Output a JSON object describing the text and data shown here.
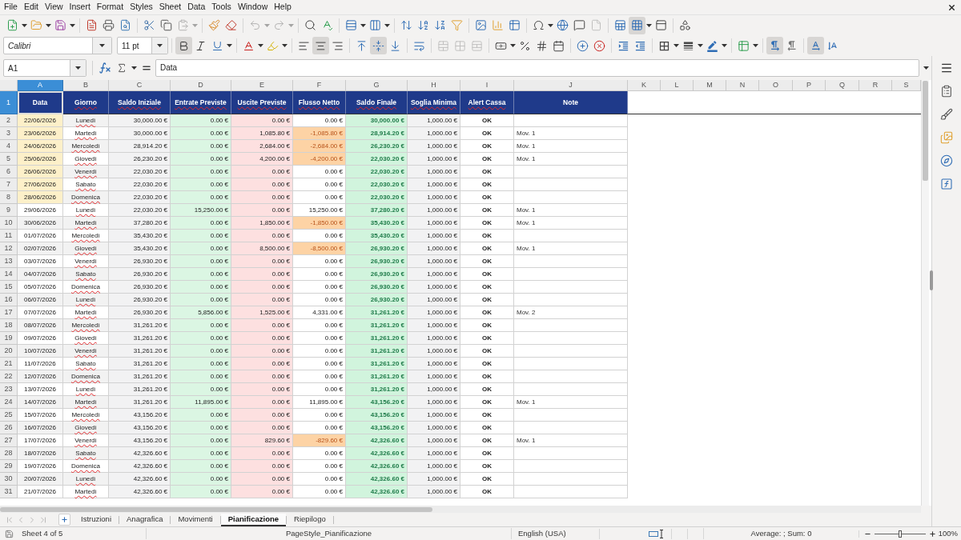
{
  "menu": [
    "File",
    "Edit",
    "View",
    "Insert",
    "Format",
    "Styles",
    "Sheet",
    "Data",
    "Tools",
    "Window",
    "Help"
  ],
  "toolbar_states": {
    "paste": {
      "disabled": true
    },
    "undo": {
      "disabled": true
    },
    "redo": {
      "disabled": true
    },
    "headers_footers": {
      "disabled": true
    },
    "freeze": {
      "pressed": true
    },
    "bold": {
      "pressed": true
    },
    "italic": {
      "pressed": false
    },
    "underline": {
      "pressed": false
    },
    "align_left": {
      "pressed": false
    },
    "align_center": {
      "pressed": true
    },
    "align_right": {
      "pressed": false
    },
    "valign_top": {
      "pressed": false
    },
    "valign_middle": {
      "pressed": true
    },
    "valign_bottom": {
      "pressed": false
    },
    "merge_center": {
      "disabled": true
    },
    "merge": {
      "disabled": true
    },
    "unmerge": {
      "disabled": true
    },
    "paragraph_ltr": {
      "pressed": true
    },
    "paragraph_rtl": {
      "pressed": false
    },
    "text_horizontal": {
      "pressed": true
    },
    "text_vertical": {
      "pressed": false
    }
  },
  "font": {
    "name": "Calibri",
    "size": "11 pt"
  },
  "formula_bar": {
    "cell_reference": "A1",
    "content": "Data"
  },
  "columns": [
    {
      "letter": "A",
      "selected": true
    },
    {
      "letter": "B",
      "selected": false
    },
    {
      "letter": "C",
      "selected": false
    },
    {
      "letter": "D",
      "selected": false
    },
    {
      "letter": "E",
      "selected": false
    },
    {
      "letter": "F",
      "selected": false
    },
    {
      "letter": "G",
      "selected": false
    },
    {
      "letter": "H",
      "selected": false
    },
    {
      "letter": "I",
      "selected": false
    },
    {
      "letter": "J",
      "selected": false
    },
    {
      "letter": "K",
      "selected": false
    },
    {
      "letter": "L",
      "selected": false
    },
    {
      "letter": "M",
      "selected": false
    },
    {
      "letter": "N",
      "selected": false
    },
    {
      "letter": "O",
      "selected": false
    },
    {
      "letter": "P",
      "selected": false
    },
    {
      "letter": "Q",
      "selected": false
    },
    {
      "letter": "R",
      "selected": false
    },
    {
      "letter": "S",
      "selected": false
    }
  ],
  "table": {
    "header_row": {
      "number": "1",
      "selected": true
    },
    "headers": [
      {
        "title": "Data",
        "selected": true,
        "misspelled": false,
        "values_misspelled": false
      },
      {
        "title": "Giorno",
        "selected": false,
        "misspelled": true,
        "values_misspelled": true
      },
      {
        "title": "Saldo Iniziale",
        "selected": false,
        "misspelled": true,
        "values_misspelled": false
      },
      {
        "title": "Entrate Previste",
        "selected": false,
        "misspelled": true,
        "values_misspelled": false
      },
      {
        "title": "Uscite Previste",
        "selected": false,
        "misspelled": true,
        "values_misspelled": false
      },
      {
        "title": "Flusso Netto",
        "selected": false,
        "misspelled": true,
        "values_misspelled": false
      },
      {
        "title": "Saldo Finale",
        "selected": false,
        "misspelled": true,
        "values_misspelled": false
      },
      {
        "title": "Soglia Minima",
        "selected": false,
        "misspelled": true,
        "values_misspelled": false
      },
      {
        "title": "Alert Cassa",
        "selected": false,
        "misspelled": true,
        "values_misspelled": false
      },
      {
        "title": "Note",
        "selected": false,
        "misspelled": false,
        "values_misspelled": false
      }
    ],
    "rows": [
      {
        "number": "2",
        "selected": false,
        "highlighted": true,
        "negative": false,
        "date": "22/06/2026",
        "day": "Lunedì",
        "opening": "30,000.00 €",
        "inflow": "0.00 €",
        "outflow": "0.00 €",
        "net": "0.00 €",
        "closing": "30,000.00 €",
        "threshold": "1,000.00 €",
        "alert": "OK"
      },
      {
        "number": "3",
        "selected": false,
        "highlighted": true,
        "negative": true,
        "date": "23/06/2026",
        "day": "Martedì",
        "opening": "30,000.00 €",
        "inflow": "0.00 €",
        "outflow": "1,085.80 €",
        "net": "-1,085.80 €",
        "closing": "28,914.20 €",
        "threshold": "1,000.00 €",
        "alert": "OK",
        "note": "Mov. 1"
      },
      {
        "number": "4",
        "selected": false,
        "highlighted": true,
        "negative": true,
        "date": "24/06/2026",
        "day": "Mercoledì",
        "opening": "28,914.20 €",
        "inflow": "0.00 €",
        "outflow": "2,684.00 €",
        "net": "-2,684.00 €",
        "closing": "26,230.20 €",
        "threshold": "1,000.00 €",
        "alert": "OK",
        "note": "Mov. 1"
      },
      {
        "number": "5",
        "selected": false,
        "highlighted": true,
        "negative": true,
        "date": "25/06/2026",
        "day": "Giovedì",
        "opening": "26,230.20 €",
        "inflow": "0.00 €",
        "outflow": "4,200.00 €",
        "net": "-4,200.00 €",
        "closing": "22,030.20 €",
        "threshold": "1,000.00 €",
        "alert": "OK",
        "note": "Mov. 1"
      },
      {
        "number": "6",
        "selected": false,
        "highlighted": true,
        "negative": false,
        "date": "26/06/2026",
        "day": "Venerdì",
        "opening": "22,030.20 €",
        "inflow": "0.00 €",
        "outflow": "0.00 €",
        "net": "0.00 €",
        "closing": "22,030.20 €",
        "threshold": "1,000.00 €",
        "alert": "OK"
      },
      {
        "number": "7",
        "selected": false,
        "highlighted": true,
        "negative": false,
        "date": "27/06/2026",
        "day": "Sabato",
        "opening": "22,030.20 €",
        "inflow": "0.00 €",
        "outflow": "0.00 €",
        "net": "0.00 €",
        "closing": "22,030.20 €",
        "threshold": "1,000.00 €",
        "alert": "OK"
      },
      {
        "number": "8",
        "selected": false,
        "highlighted": true,
        "negative": false,
        "date": "28/06/2026",
        "day": "Domenica",
        "opening": "22,030.20 €",
        "inflow": "0.00 €",
        "outflow": "0.00 €",
        "net": "0.00 €",
        "closing": "22,030.20 €",
        "threshold": "1,000.00 €",
        "alert": "OK"
      },
      {
        "number": "9",
        "selected": false,
        "highlighted": false,
        "negative": false,
        "date": "29/06/2026",
        "day": "Lunedì",
        "opening": "22,030.20 €",
        "inflow": "15,250.00 €",
        "outflow": "0.00 €",
        "net": "15,250.00 €",
        "closing": "37,280.20 €",
        "threshold": "1,000.00 €",
        "alert": "OK",
        "note": "Mov. 1"
      },
      {
        "number": "10",
        "selected": false,
        "highlighted": false,
        "negative": true,
        "date": "30/06/2026",
        "day": "Martedì",
        "opening": "37,280.20 €",
        "inflow": "0.00 €",
        "outflow": "1,850.00 €",
        "net": "-1,850.00 €",
        "closing": "35,430.20 €",
        "threshold": "1,000.00 €",
        "alert": "OK",
        "note": "Mov. 1"
      },
      {
        "number": "11",
        "selected": false,
        "highlighted": false,
        "negative": false,
        "date": "01/07/2026",
        "day": "Mercoledì",
        "opening": "35,430.20 €",
        "inflow": "0.00 €",
        "outflow": "0.00 €",
        "net": "0.00 €",
        "closing": "35,430.20 €",
        "threshold": "1,000.00 €",
        "alert": "OK"
      },
      {
        "number": "12",
        "selected": false,
        "highlighted": false,
        "negative": true,
        "date": "02/07/2026",
        "day": "Giovedì",
        "opening": "35,430.20 €",
        "inflow": "0.00 €",
        "outflow": "8,500.00 €",
        "net": "-8,500.00 €",
        "closing": "26,930.20 €",
        "threshold": "1,000.00 €",
        "alert": "OK",
        "note": "Mov. 1"
      },
      {
        "number": "13",
        "selected": false,
        "highlighted": false,
        "negative": false,
        "date": "03/07/2026",
        "day": "Venerdì",
        "opening": "26,930.20 €",
        "inflow": "0.00 €",
        "outflow": "0.00 €",
        "net": "0.00 €",
        "closing": "26,930.20 €",
        "threshold": "1,000.00 €",
        "alert": "OK"
      },
      {
        "number": "14",
        "selected": false,
        "highlighted": false,
        "negative": false,
        "date": "04/07/2026",
        "day": "Sabato",
        "opening": "26,930.20 €",
        "inflow": "0.00 €",
        "outflow": "0.00 €",
        "net": "0.00 €",
        "closing": "26,930.20 €",
        "threshold": "1,000.00 €",
        "alert": "OK"
      },
      {
        "number": "15",
        "selected": false,
        "highlighted": false,
        "negative": false,
        "date": "05/07/2026",
        "day": "Domenica",
        "opening": "26,930.20 €",
        "inflow": "0.00 €",
        "outflow": "0.00 €",
        "net": "0.00 €",
        "closing": "26,930.20 €",
        "threshold": "1,000.00 €",
        "alert": "OK"
      },
      {
        "number": "16",
        "selected": false,
        "highlighted": false,
        "negative": false,
        "date": "06/07/2026",
        "day": "Lunedì",
        "opening": "26,930.20 €",
        "inflow": "0.00 €",
        "outflow": "0.00 €",
        "net": "0.00 €",
        "closing": "26,930.20 €",
        "threshold": "1,000.00 €",
        "alert": "OK"
      },
      {
        "number": "17",
        "selected": false,
        "highlighted": false,
        "negative": false,
        "date": "07/07/2026",
        "day": "Martedì",
        "opening": "26,930.20 €",
        "inflow": "5,856.00 €",
        "outflow": "1,525.00 €",
        "net": "4,331.00 €",
        "closing": "31,261.20 €",
        "threshold": "1,000.00 €",
        "alert": "OK",
        "note": "Mov. 2"
      },
      {
        "number": "18",
        "selected": false,
        "highlighted": false,
        "negative": false,
        "date": "08/07/2026",
        "day": "Mercoledì",
        "opening": "31,261.20 €",
        "inflow": "0.00 €",
        "outflow": "0.00 €",
        "net": "0.00 €",
        "closing": "31,261.20 €",
        "threshold": "1,000.00 €",
        "alert": "OK"
      },
      {
        "number": "19",
        "selected": false,
        "highlighted": false,
        "negative": false,
        "date": "09/07/2026",
        "day": "Giovedì",
        "opening": "31,261.20 €",
        "inflow": "0.00 €",
        "outflow": "0.00 €",
        "net": "0.00 €",
        "closing": "31,261.20 €",
        "threshold": "1,000.00 €",
        "alert": "OK"
      },
      {
        "number": "20",
        "selected": false,
        "highlighted": false,
        "negative": false,
        "date": "10/07/2026",
        "day": "Venerdì",
        "opening": "31,261.20 €",
        "inflow": "0.00 €",
        "outflow": "0.00 €",
        "net": "0.00 €",
        "closing": "31,261.20 €",
        "threshold": "1,000.00 €",
        "alert": "OK"
      },
      {
        "number": "21",
        "selected": false,
        "highlighted": false,
        "negative": false,
        "date": "11/07/2026",
        "day": "Sabato",
        "opening": "31,261.20 €",
        "inflow": "0.00 €",
        "outflow": "0.00 €",
        "net": "0.00 €",
        "closing": "31,261.20 €",
        "threshold": "1,000.00 €",
        "alert": "OK"
      },
      {
        "number": "22",
        "selected": false,
        "highlighted": false,
        "negative": false,
        "date": "12/07/2026",
        "day": "Domenica",
        "opening": "31,261.20 €",
        "inflow": "0.00 €",
        "outflow": "0.00 €",
        "net": "0.00 €",
        "closing": "31,261.20 €",
        "threshold": "1,000.00 €",
        "alert": "OK"
      },
      {
        "number": "23",
        "selected": false,
        "highlighted": false,
        "negative": false,
        "date": "13/07/2026",
        "day": "Lunedì",
        "opening": "31,261.20 €",
        "inflow": "0.00 €",
        "outflow": "0.00 €",
        "net": "0.00 €",
        "closing": "31,261.20 €",
        "threshold": "1,000.00 €",
        "alert": "OK"
      },
      {
        "number": "24",
        "selected": false,
        "highlighted": false,
        "negative": false,
        "date": "14/07/2026",
        "day": "Martedì",
        "opening": "31,261.20 €",
        "inflow": "11,895.00 €",
        "outflow": "0.00 €",
        "net": "11,895.00 €",
        "closing": "43,156.20 €",
        "threshold": "1,000.00 €",
        "alert": "OK",
        "note": "Mov. 1"
      },
      {
        "number": "25",
        "selected": false,
        "highlighted": false,
        "negative": false,
        "date": "15/07/2026",
        "day": "Mercoledì",
        "opening": "43,156.20 €",
        "inflow": "0.00 €",
        "outflow": "0.00 €",
        "net": "0.00 €",
        "closing": "43,156.20 €",
        "threshold": "1,000.00 €",
        "alert": "OK"
      },
      {
        "number": "26",
        "selected": false,
        "highlighted": false,
        "negative": false,
        "date": "16/07/2026",
        "day": "Giovedì",
        "opening": "43,156.20 €",
        "inflow": "0.00 €",
        "outflow": "0.00 €",
        "net": "0.00 €",
        "closing": "43,156.20 €",
        "threshold": "1,000.00 €",
        "alert": "OK"
      },
      {
        "number": "27",
        "selected": false,
        "highlighted": false,
        "negative": true,
        "date": "17/07/2026",
        "day": "Venerdì",
        "opening": "43,156.20 €",
        "inflow": "0.00 €",
        "outflow": "829.60 €",
        "net": "-829.60 €",
        "closing": "42,326.60 €",
        "threshold": "1,000.00 €",
        "alert": "OK",
        "note": "Mov. 1"
      },
      {
        "number": "28",
        "selected": false,
        "highlighted": false,
        "negative": false,
        "date": "18/07/2026",
        "day": "Sabato",
        "opening": "42,326.60 €",
        "inflow": "0.00 €",
        "outflow": "0.00 €",
        "net": "0.00 €",
        "closing": "42,326.60 €",
        "threshold": "1,000.00 €",
        "alert": "OK"
      },
      {
        "number": "29",
        "selected": false,
        "highlighted": false,
        "negative": false,
        "date": "19/07/2026",
        "day": "Domenica",
        "opening": "42,326.60 €",
        "inflow": "0.00 €",
        "outflow": "0.00 €",
        "net": "0.00 €",
        "closing": "42,326.60 €",
        "threshold": "1,000.00 €",
        "alert": "OK"
      },
      {
        "number": "30",
        "selected": false,
        "highlighted": false,
        "negative": false,
        "date": "20/07/2026",
        "day": "Lunedì",
        "opening": "42,326.60 €",
        "inflow": "0.00 €",
        "outflow": "0.00 €",
        "net": "0.00 €",
        "closing": "42,326.60 €",
        "threshold": "1,000.00 €",
        "alert": "OK"
      },
      {
        "number": "31",
        "selected": false,
        "highlighted": false,
        "negative": false,
        "date": "21/07/2026",
        "day": "Martedì",
        "opening": "42,326.60 €",
        "inflow": "0.00 €",
        "outflow": "0.00 €",
        "net": "0.00 €",
        "closing": "42,326.60 €",
        "threshold": "1,000.00 €",
        "alert": "OK"
      }
    ]
  },
  "sheet_tabs": {
    "nav_disabled": true,
    "tabs": [
      {
        "label": "Istruzioni",
        "selected": false
      },
      {
        "label": "Anagrafica",
        "selected": false
      },
      {
        "label": "Movimenti",
        "selected": false
      },
      {
        "label": "Pianificazione",
        "selected": true
      },
      {
        "label": "Riepilogo",
        "selected": false
      }
    ]
  },
  "status_bar": {
    "sheet": "Sheet 4 of 5",
    "page_style": "PageStyle_Pianificazione",
    "language": "English (USA)",
    "selection_summary": "Average: ; Sum: 0",
    "zoom_slider": {
      "level": 0.5
    },
    "zoom": "100%"
  }
}
